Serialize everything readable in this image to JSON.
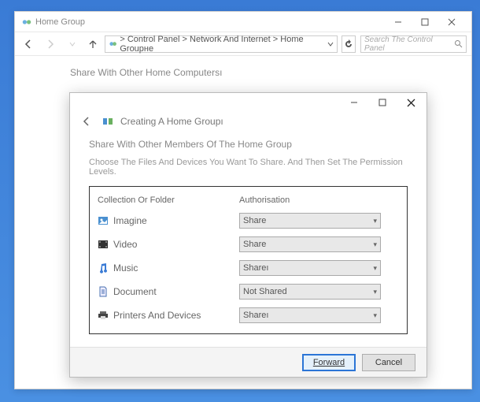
{
  "outer": {
    "title": "Home Group",
    "breadcrumb": "> Control Panel > Network And Internet > Home Groupне",
    "search_placeholder": "Search The Control Panel",
    "heading": "Share With Other Home Computersı"
  },
  "modal": {
    "title": "Creating A Home Groupı",
    "subtitle": "Share With Other Members Of The Home Group",
    "desc": "Choose The Files And Devices You Want To Share. And Then Set The Permission Levels.",
    "col_folder": "Collection Or Folder",
    "col_auth": "Authorisation",
    "rows": [
      {
        "label": "Imagine",
        "value": "Share"
      },
      {
        "label": "Video",
        "value": "Share"
      },
      {
        "label": "Music",
        "value": "Shareı"
      },
      {
        "label": "Document",
        "value": "Not Shared"
      },
      {
        "label": "Printers And Devices",
        "value": "Shareı"
      }
    ],
    "forward": "Forward",
    "cancel": "Cancel"
  }
}
